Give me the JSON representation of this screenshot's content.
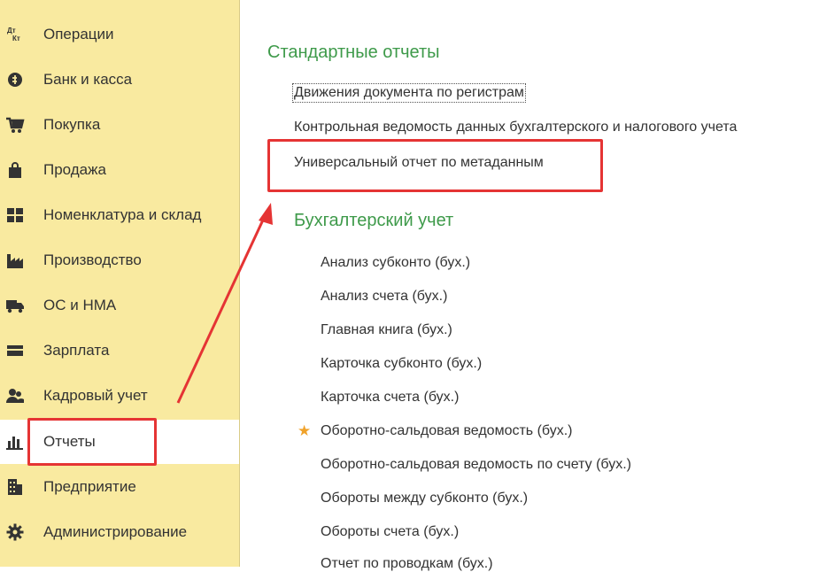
{
  "sidebar": {
    "items": [
      {
        "label": "Операции",
        "icon": "dt-kt-icon"
      },
      {
        "label": "Банк и касса",
        "icon": "coin-icon"
      },
      {
        "label": "Покупка",
        "icon": "cart-icon"
      },
      {
        "label": "Продажа",
        "icon": "bag-icon"
      },
      {
        "label": "Номенклатура и склад",
        "icon": "grid-icon"
      },
      {
        "label": "Производство",
        "icon": "factory-icon"
      },
      {
        "label": "ОС и НМА",
        "icon": "truck-icon"
      },
      {
        "label": "Зарплата",
        "icon": "wallet-icon"
      },
      {
        "label": "Кадровый учет",
        "icon": "people-icon"
      },
      {
        "label": "Отчеты",
        "icon": "bar-chart-icon",
        "active": true
      },
      {
        "label": "Предприятие",
        "icon": "building-icon"
      },
      {
        "label": "Администрирование",
        "icon": "gear-icon"
      }
    ],
    "icon_glyphs": {
      "dt_kt_top": "Дт",
      "dt_kt_bottom": "Кт"
    }
  },
  "main": {
    "standard_reports": {
      "title": "Стандартные отчеты",
      "items": [
        "Движения документа по регистрам",
        "Контрольная ведомость данных бухгалтерского и налогового учета",
        "Универсальный отчет по метаданным"
      ]
    },
    "accounting": {
      "title": "Бухгалтерский учет",
      "items": [
        "Анализ субконто (бух.)",
        "Анализ счета (бух.)",
        "Главная книга (бух.)",
        "Карточка субконто (бух.)",
        "Карточка счета (бух.)",
        "Оборотно-сальдовая ведомость (бух.)",
        "Оборотно-сальдовая ведомость по счету (бух.)",
        "Обороты между субконто (бух.)",
        "Обороты счета (бух.)",
        "Отчет по проводкам (бух.)"
      ],
      "favorite_mark": "★"
    }
  },
  "colors": {
    "sidebar_bg": "#f9eaa0",
    "section_title": "#3e9a4a",
    "highlight": "#e53434",
    "favorite_star": "#f0a22a"
  }
}
